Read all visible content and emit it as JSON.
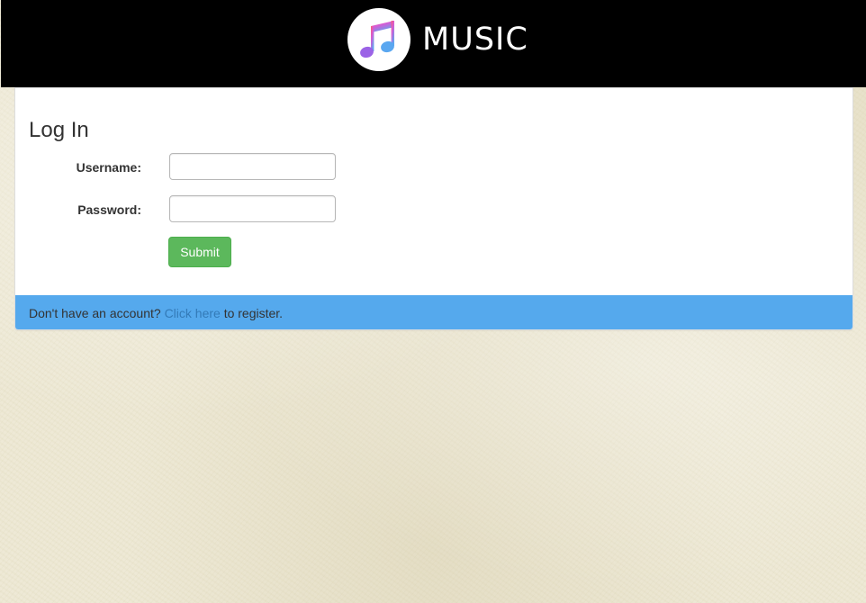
{
  "header": {
    "logo_icon": "music-note-icon",
    "brand_name": "MUSIC",
    "background_color": "#000000"
  },
  "login": {
    "title": "Log In",
    "username_label": "Username:",
    "username_value": "",
    "password_label": "Password:",
    "password_value": "",
    "submit_label": "Submit",
    "submit_color": "#5cb85c"
  },
  "footer": {
    "prefix_text": "Don't have an account?",
    "link_text": "Click here",
    "suffix_text": "to register.",
    "background_color": "#55a9ed",
    "link_color": "#337ab7"
  }
}
